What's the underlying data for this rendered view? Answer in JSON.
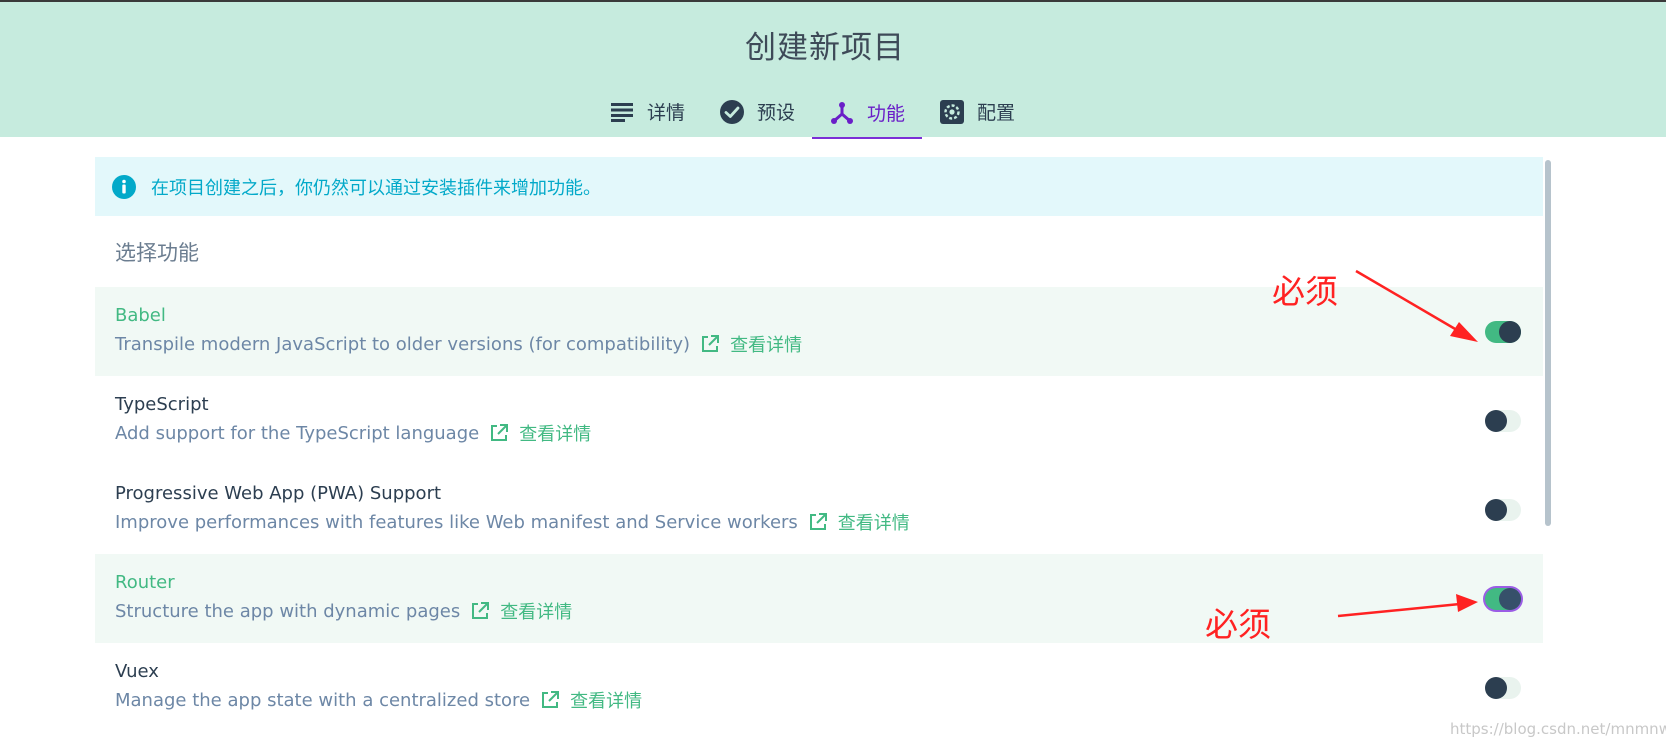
{
  "header": {
    "title": "创建新项目",
    "tabs": [
      {
        "label": "详情",
        "icon": "list-icon",
        "active": false
      },
      {
        "label": "预设",
        "icon": "check-circle-icon",
        "active": false
      },
      {
        "label": "功能",
        "icon": "merge-icon",
        "active": true
      },
      {
        "label": "配置",
        "icon": "gear-icon",
        "active": false
      }
    ]
  },
  "notice": {
    "icon": "info-icon",
    "text": "在项目创建之后，你仍然可以通过安装插件来增加功能。"
  },
  "features": {
    "section_title": "选择功能",
    "more_label": "查看详情",
    "items": [
      {
        "name": "Babel",
        "description": "Transpile modern JavaScript to older versions (for compatibility)",
        "enabled": true
      },
      {
        "name": "TypeScript",
        "description": "Add support for the TypeScript language",
        "enabled": false
      },
      {
        "name": "Progressive Web App (PWA) Support",
        "description": "Improve performances with features like Web manifest and Service workers",
        "enabled": false
      },
      {
        "name": "Router",
        "description": "Structure the app with dynamic pages",
        "enabled": true
      },
      {
        "name": "Vuex",
        "description": "Manage the app state with a centralized store",
        "enabled": false
      }
    ]
  },
  "annotations": {
    "babel_required": "必须",
    "router_required": "必须"
  },
  "watermark": "https://blog.csdn.net/mnmnwq",
  "colors": {
    "header_bg": "#c6ebde",
    "accent_green": "#42b983",
    "active_tab": "#7b2fd6",
    "notice_text": "#03a9c9",
    "annotation_red": "#ff2222"
  }
}
